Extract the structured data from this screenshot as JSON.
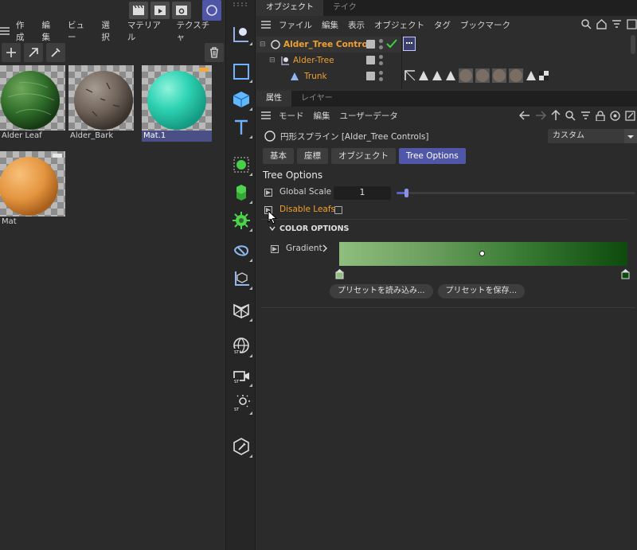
{
  "material_manager": {
    "menu": [
      "作成",
      "編集",
      "ビュー",
      "選択",
      "マテリアル",
      "テクスチャ"
    ],
    "materials": [
      {
        "name": "Alder Leaf",
        "selected": false
      },
      {
        "name": "Alder_Bark",
        "selected": false
      },
      {
        "name": "Mat.1",
        "selected": true
      },
      {
        "name": "Mat",
        "selected": false
      }
    ]
  },
  "object_manager": {
    "tabs": [
      "オブジェクト",
      "テイク"
    ],
    "menu": [
      "ファイル",
      "編集",
      "表示",
      "オブジェクト",
      "タグ",
      "ブックマーク"
    ],
    "objects": [
      {
        "name": "Alder_Tree Controls",
        "color": "#f0a030"
      },
      {
        "name": "Alder-Tree",
        "color": "#f0a030"
      },
      {
        "name": "Trunk",
        "color": "#f0a030"
      }
    ]
  },
  "attribute_manager": {
    "tabs": [
      "属性",
      "レイヤー"
    ],
    "menu": [
      "モード",
      "編集",
      "ユーザーデータ"
    ],
    "object_title": "円形スプライン [Alder_Tree Controls]",
    "preset_dropdown": "カスタム",
    "section_tabs": [
      "基本",
      "座標",
      "オブジェクト",
      "Tree Options"
    ],
    "active_section": "Tree Options",
    "section_title": "Tree Options",
    "global_scale_label": "Global Scale",
    "global_scale_value": "1",
    "global_scale_slider_fraction": 0.0,
    "disable_leafs_label": "Disable Leafs",
    "disable_leafs_checked": false,
    "color_options_title": "COLOR OPTIONS",
    "gradient_label": "Gradient",
    "gradient_colors": [
      "#8fbf7f",
      "#0d4a0d"
    ],
    "load_preset_label": "プリセットを読み込み...",
    "save_preset_label": "プリセットを保存..."
  },
  "colors": {
    "accent": "#5057a8",
    "highlight_orange": "#f0a030",
    "check_green": "#3fcf3f"
  }
}
